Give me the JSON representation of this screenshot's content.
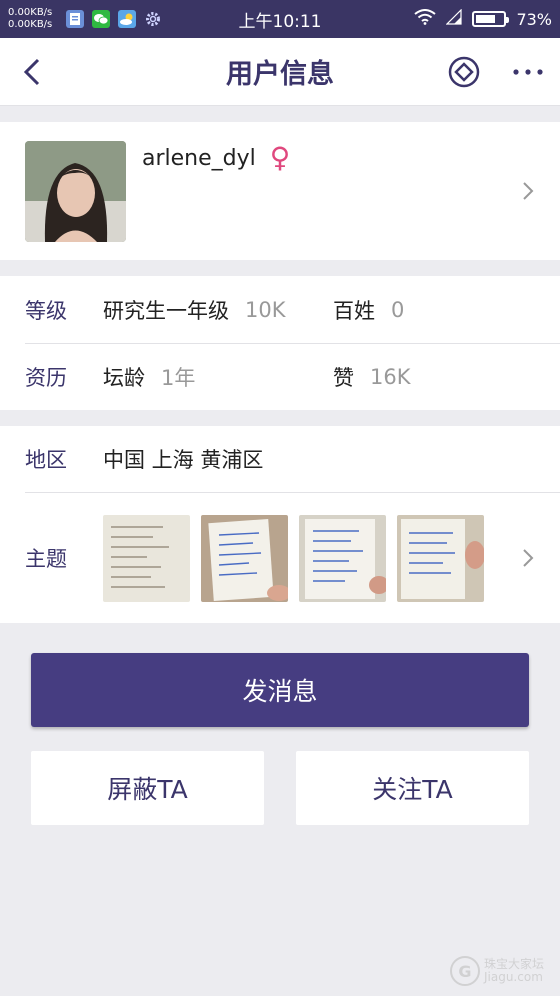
{
  "status_bar": {
    "net_up": "0.00KB/s",
    "net_down": "0.00KB/s",
    "time": "上午10:11",
    "battery": "73%",
    "battery_level": 0.73,
    "app_icons": [
      "notepad-icon",
      "wechat-icon",
      "weather-icon",
      "gear-icon"
    ]
  },
  "header": {
    "title": "用户信息"
  },
  "profile": {
    "username": "arlene_dyl",
    "gender_symbol": "♀"
  },
  "stats": {
    "level_label": "等级",
    "level_value": "研究生一年级",
    "level_count": "10K",
    "rank_label": "百姓",
    "rank_count": "0",
    "history_label": "资历",
    "age_label": "坛龄",
    "age_value": "1年",
    "likes_label": "赞",
    "likes_value": "16K"
  },
  "region": {
    "label": "地区",
    "value": "中国 上海 黄浦区"
  },
  "topics": {
    "label": "主题",
    "thumbnail_count": 4
  },
  "actions": {
    "message": "发消息",
    "block": "屏蔽TA",
    "follow": "关注TA"
  },
  "watermark": {
    "line1": "珠宝大家坛",
    "line2": "Jiagu.com"
  },
  "colors": {
    "accent": "#463d81",
    "title": "#3b356b",
    "gender": "#e0487e",
    "status_bar": "#3a3564"
  }
}
